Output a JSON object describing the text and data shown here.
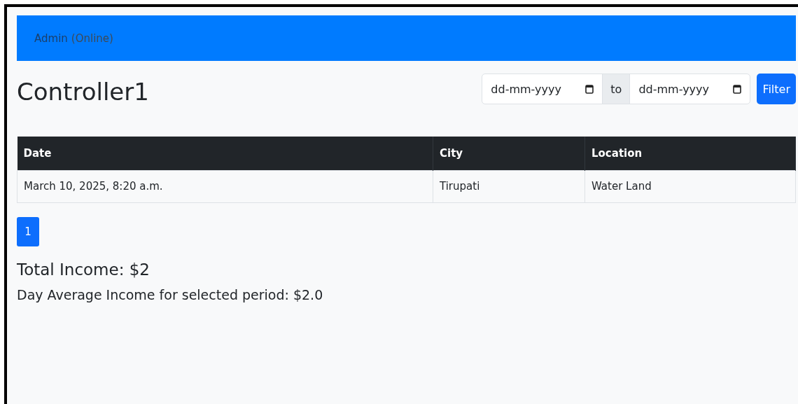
{
  "navbar": {
    "user": "Admin",
    "status": "(Online)"
  },
  "title": "Controller1",
  "filter": {
    "from_placeholder": "dd-mm-yyyy",
    "separator": "to",
    "to_placeholder": "dd-mm-yyyy",
    "button": "Filter"
  },
  "table": {
    "columns": [
      "Date",
      "City",
      "Location"
    ],
    "rows": [
      [
        "March 10, 2025, 8:20 a.m.",
        "Tirupati",
        "Water Land"
      ]
    ]
  },
  "pagination": [
    {
      "label": "1",
      "selected": true
    }
  ],
  "total_income": "Total Income: $2",
  "day_average": "Day Average Income for selected period: $2.0"
}
